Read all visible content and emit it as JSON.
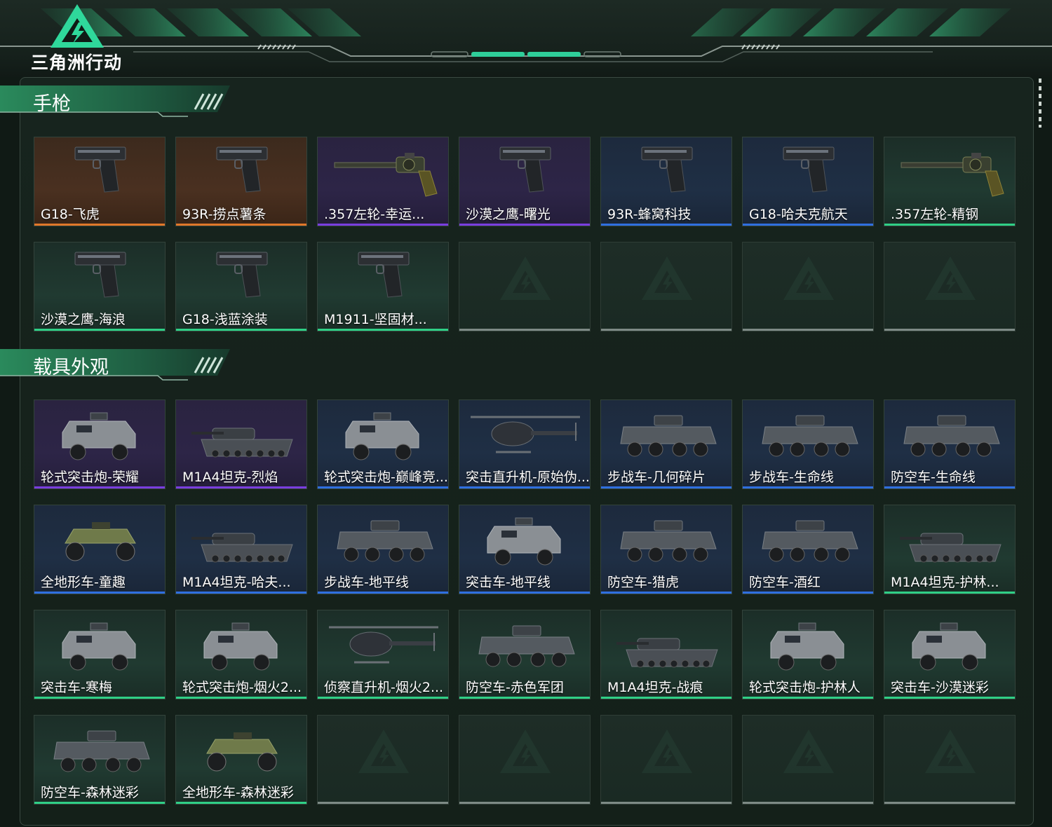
{
  "app": {
    "logo_text": "三角洲行动"
  },
  "colors": {
    "orange": "#e0782a",
    "purple": "#7a3ee0",
    "blue": "#2f6fe0",
    "green": "#2fcf86",
    "empty": "#7d8a85"
  },
  "sections": [
    {
      "title": "手枪",
      "items": [
        {
          "name": "G18-飞虎",
          "rarity": "orange",
          "icon": "pistol-icon"
        },
        {
          "name": "93R-捞点薯条",
          "rarity": "orange",
          "icon": "pistol-icon"
        },
        {
          "name": ".357左轮-幸运...",
          "rarity": "purple",
          "icon": "revolver-icon"
        },
        {
          "name": "沙漠之鹰-曙光",
          "rarity": "purple",
          "icon": "pistol-icon"
        },
        {
          "name": "93R-蜂窝科技",
          "rarity": "blue",
          "icon": "pistol-icon"
        },
        {
          "name": "G18-哈夫克航天",
          "rarity": "blue",
          "icon": "pistol-icon"
        },
        {
          "name": ".357左轮-精钢",
          "rarity": "green",
          "icon": "revolver-icon"
        },
        {
          "name": "沙漠之鹰-海浪",
          "rarity": "green",
          "icon": "pistol-icon"
        },
        {
          "name": "G18-浅蓝涂装",
          "rarity": "green",
          "icon": "pistol-icon"
        },
        {
          "name": "M1911-坚固材...",
          "rarity": "green",
          "icon": "pistol-icon"
        }
      ],
      "empty_slots": 4
    },
    {
      "title": "载具外观",
      "items": [
        {
          "name": "轮式突击炮-荣耀",
          "rarity": "purple",
          "icon": "armored-car-icon"
        },
        {
          "name": "M1A4坦克-烈焰",
          "rarity": "purple",
          "icon": "tank-icon"
        },
        {
          "name": "轮式突击炮-巅峰竞...",
          "rarity": "blue",
          "icon": "armored-car-icon"
        },
        {
          "name": "突击直升机-原始伪...",
          "rarity": "blue",
          "icon": "helicopter-icon"
        },
        {
          "name": "步战车-几何碎片",
          "rarity": "blue",
          "icon": "ifv-icon"
        },
        {
          "name": "步战车-生命线",
          "rarity": "blue",
          "icon": "ifv-icon"
        },
        {
          "name": "防空车-生命线",
          "rarity": "blue",
          "icon": "ifv-icon"
        },
        {
          "name": "全地形车-童趣",
          "rarity": "blue",
          "icon": "atv-icon"
        },
        {
          "name": "M1A4坦克-哈夫...",
          "rarity": "blue",
          "icon": "tank-icon"
        },
        {
          "name": "步战车-地平线",
          "rarity": "blue",
          "icon": "ifv-icon"
        },
        {
          "name": "突击车-地平线",
          "rarity": "blue",
          "icon": "armored-car-icon"
        },
        {
          "name": "防空车-猎虎",
          "rarity": "blue",
          "icon": "ifv-icon"
        },
        {
          "name": "防空车-酒红",
          "rarity": "blue",
          "icon": "ifv-icon"
        },
        {
          "name": "M1A4坦克-护林...",
          "rarity": "green",
          "icon": "tank-icon"
        },
        {
          "name": "突击车-寒梅",
          "rarity": "green",
          "icon": "armored-car-icon"
        },
        {
          "name": "轮式突击炮-烟火2...",
          "rarity": "green",
          "icon": "armored-car-icon"
        },
        {
          "name": "侦察直升机-烟火2...",
          "rarity": "green",
          "icon": "helicopter-icon"
        },
        {
          "name": "防空车-赤色军团",
          "rarity": "green",
          "icon": "ifv-icon"
        },
        {
          "name": "M1A4坦克-战痕",
          "rarity": "green",
          "icon": "tank-icon"
        },
        {
          "name": "轮式突击炮-护林人",
          "rarity": "green",
          "icon": "armored-car-icon"
        },
        {
          "name": "突击车-沙漠迷彩",
          "rarity": "green",
          "icon": "armored-car-icon"
        },
        {
          "name": "防空车-森林迷彩",
          "rarity": "green",
          "icon": "ifv-icon"
        },
        {
          "name": "全地形车-森林迷彩",
          "rarity": "green",
          "icon": "atv-icon"
        }
      ],
      "empty_slots": 5
    }
  ]
}
